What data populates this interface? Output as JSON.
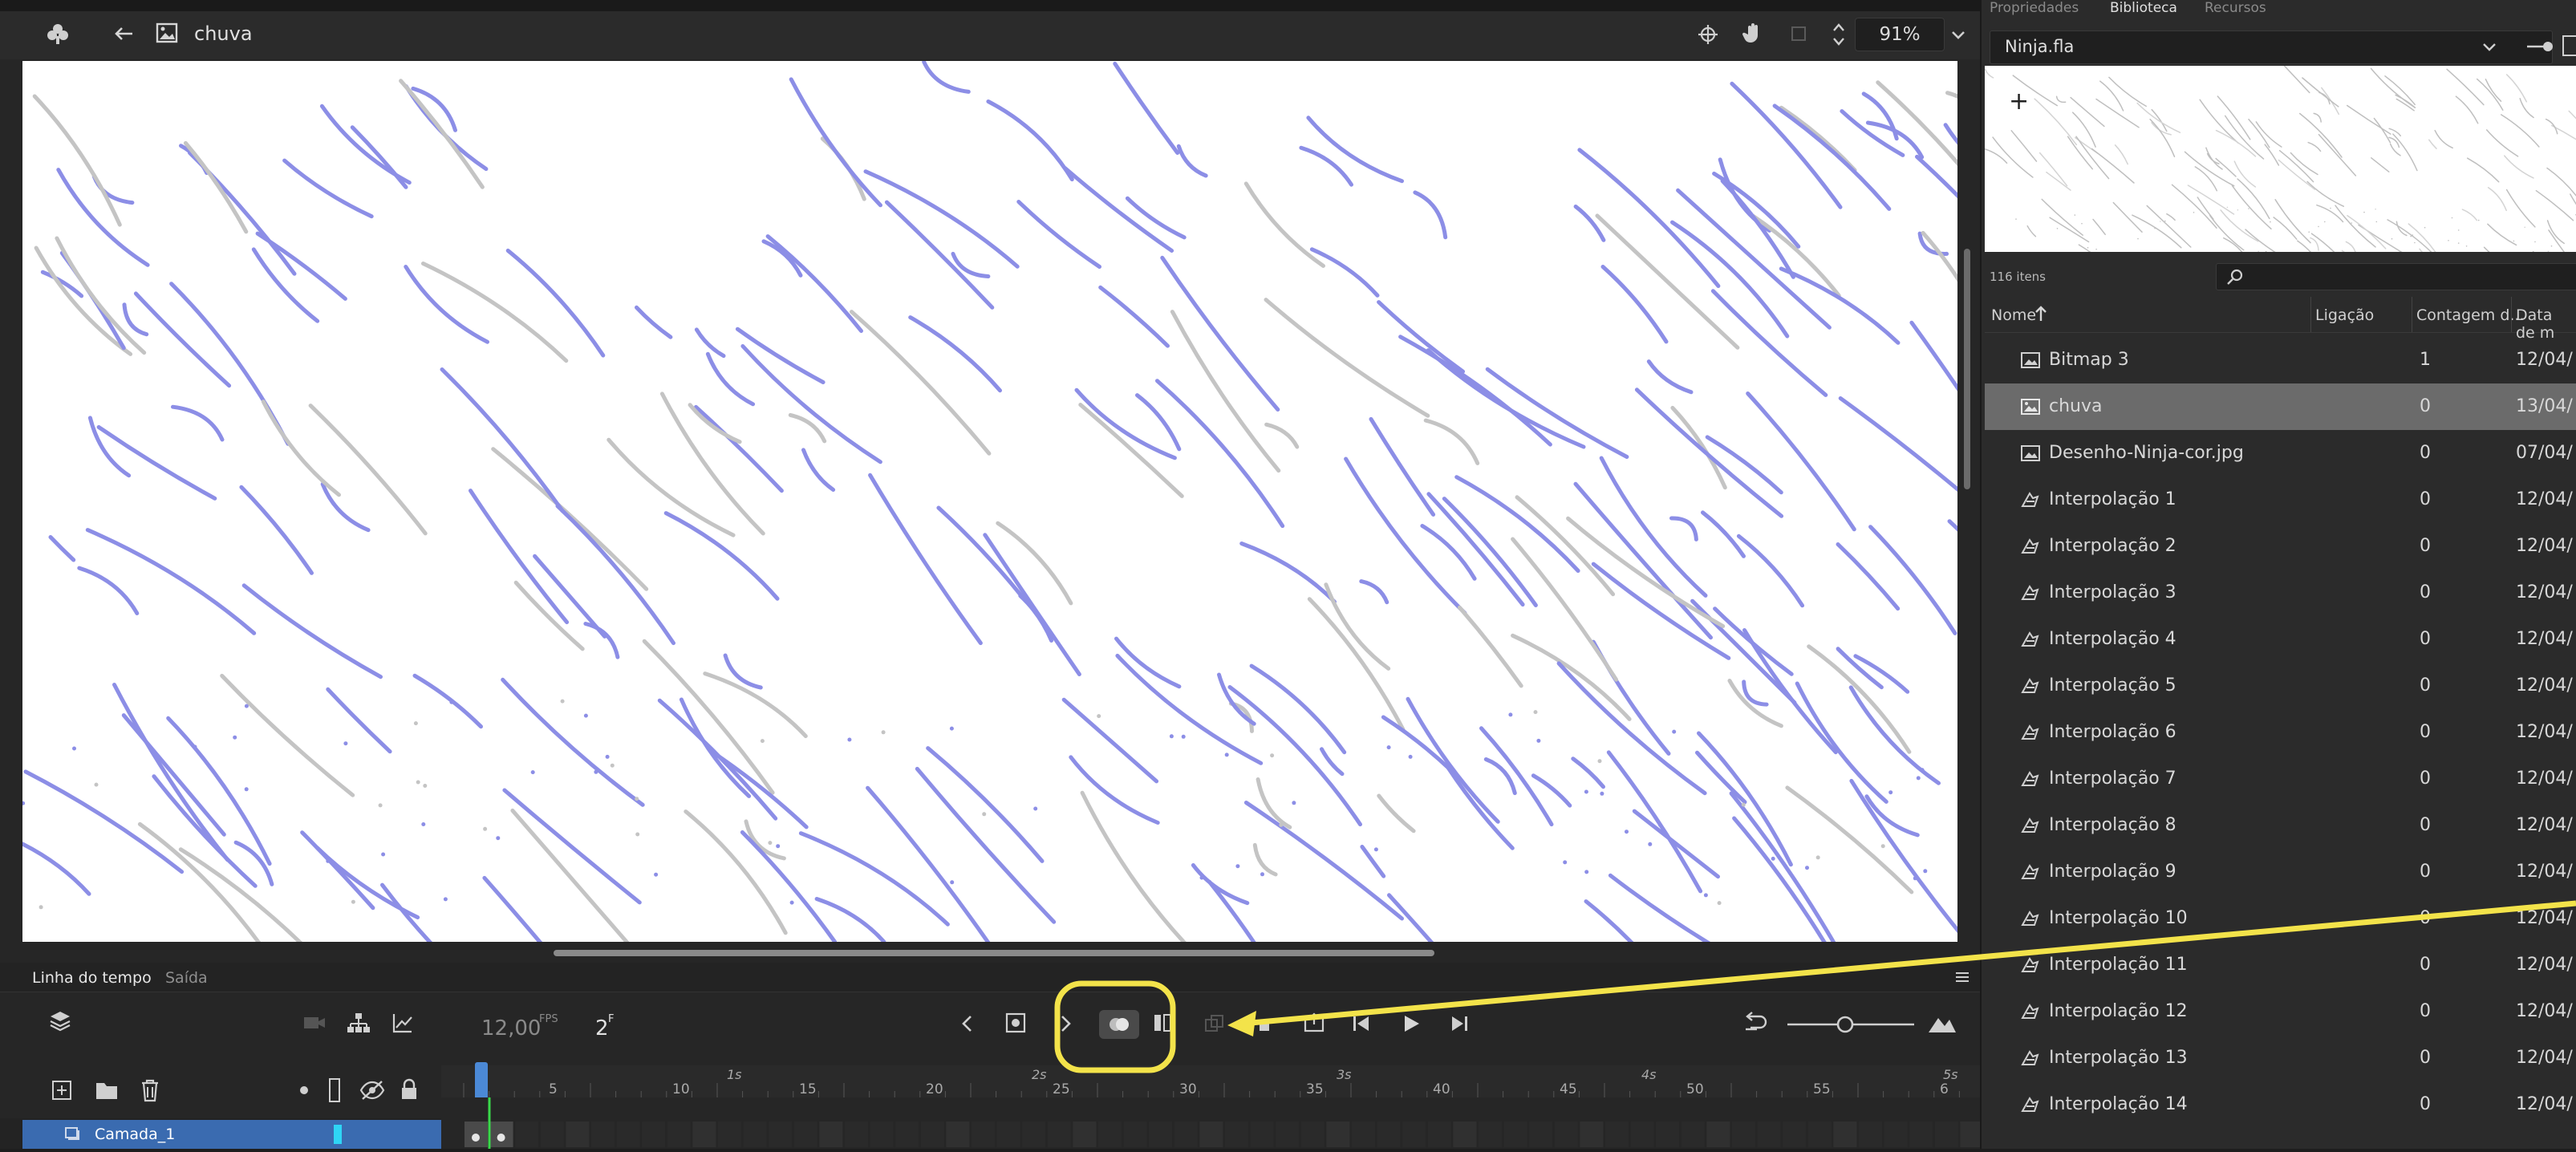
{
  "toolbar": {
    "back_icon": "arrow-left-icon",
    "symbol_name": "chuva",
    "zoom": "91%"
  },
  "timeline": {
    "tabs": [
      "Linha do tempo",
      "Saída"
    ],
    "fps": "12,00",
    "fps_unit": "FPS",
    "frame": "2",
    "frame_unit": "F",
    "ruler_seconds": [
      "1s",
      "2s",
      "3s",
      "4s",
      "5s"
    ],
    "ruler_frames": [
      "5",
      "10",
      "15",
      "20",
      "25",
      "30",
      "35",
      "40",
      "45",
      "50",
      "55",
      "6"
    ],
    "layer_name": "Camada_1"
  },
  "panel": {
    "tabs": [
      "Propriedades",
      "Biblioteca",
      "Recursos"
    ],
    "library_file": "Ninja.fla",
    "item_count": "116 itens",
    "columns": [
      "Nome",
      "Ligação",
      "Contagem d...",
      "Data de m"
    ],
    "items": [
      {
        "name": "Bitmap 3",
        "type": "bitmap",
        "count": "1",
        "date": "12/04/"
      },
      {
        "name": "chuva",
        "type": "movieclip",
        "count": "0",
        "date": "13/04/",
        "selected": true
      },
      {
        "name": "Desenho-Ninja-cor.jpg",
        "type": "bitmap",
        "count": "0",
        "date": "07/04/"
      },
      {
        "name": "Interpolação 1",
        "type": "graphic",
        "count": "0",
        "date": "12/04/"
      },
      {
        "name": "Interpolação 2",
        "type": "graphic",
        "count": "0",
        "date": "12/04/"
      },
      {
        "name": "Interpolação 3",
        "type": "graphic",
        "count": "0",
        "date": "12/04/"
      },
      {
        "name": "Interpolação 4",
        "type": "graphic",
        "count": "0",
        "date": "12/04/"
      },
      {
        "name": "Interpolação 5",
        "type": "graphic",
        "count": "0",
        "date": "12/04/"
      },
      {
        "name": "Interpolação 6",
        "type": "graphic",
        "count": "0",
        "date": "12/04/"
      },
      {
        "name": "Interpolação 7",
        "type": "graphic",
        "count": "0",
        "date": "12/04/"
      },
      {
        "name": "Interpolação 8",
        "type": "graphic",
        "count": "0",
        "date": "12/04/"
      },
      {
        "name": "Interpolação 9",
        "type": "graphic",
        "count": "0",
        "date": "12/04/"
      },
      {
        "name": "Interpolação 10",
        "type": "graphic",
        "count": "0",
        "date": "12/04/"
      },
      {
        "name": "Interpolação 11",
        "type": "graphic",
        "count": "0",
        "date": "12/04/"
      },
      {
        "name": "Interpolação 12",
        "type": "graphic",
        "count": "0",
        "date": "12/04/"
      },
      {
        "name": "Interpolação 13",
        "type": "graphic",
        "count": "0",
        "date": "12/04/"
      },
      {
        "name": "Interpolação 14",
        "type": "graphic",
        "count": "0",
        "date": "12/04/"
      }
    ]
  },
  "colors": {
    "rain_blue": "#8c8ee6",
    "rain_gray": "#c4c4c4",
    "highlight": "#f3e34a",
    "layer_blue": "#3a6bb0"
  }
}
